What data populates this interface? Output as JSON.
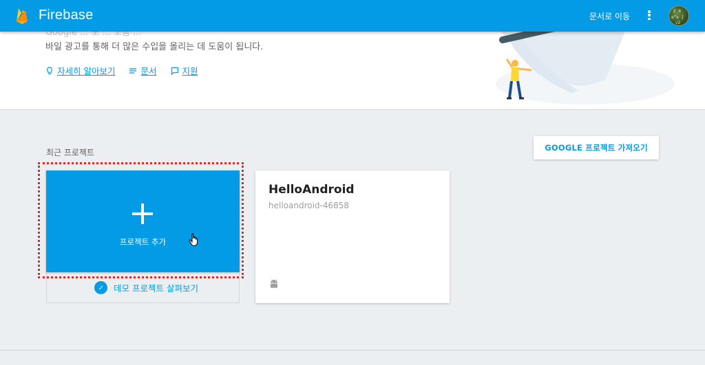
{
  "appbar": {
    "brand": "Firebase",
    "goto_label": "문서로 이동",
    "menu_icon": "more-vert-icon",
    "avatar_icon": "user-avatar"
  },
  "hero": {
    "clipped_text": "Google ... 모 ... 도움 ...",
    "text": "바일 광고를 통해 더 많은 수입을 올리는 데 도움이 됩니다.",
    "links": [
      {
        "label": "자세히 알아보기",
        "icon": "lightbulb-icon"
      },
      {
        "label": "문서",
        "icon": "list-icon"
      },
      {
        "label": "지원",
        "icon": "chat-icon"
      }
    ]
  },
  "recent": {
    "title": "최근 프로젝트",
    "import_label": "GOOGLE 프로젝트 가져오기",
    "add_label": "프로젝트 추가",
    "demo_label": "데모 프로젝트 살펴보기",
    "project": {
      "name": "HelloAndroid",
      "id": "helloandroid-46858",
      "platform_icon": "android-icon"
    }
  },
  "colors": {
    "primary": "#039be5",
    "background": "#eceff1",
    "highlight": "#d32f2f"
  }
}
